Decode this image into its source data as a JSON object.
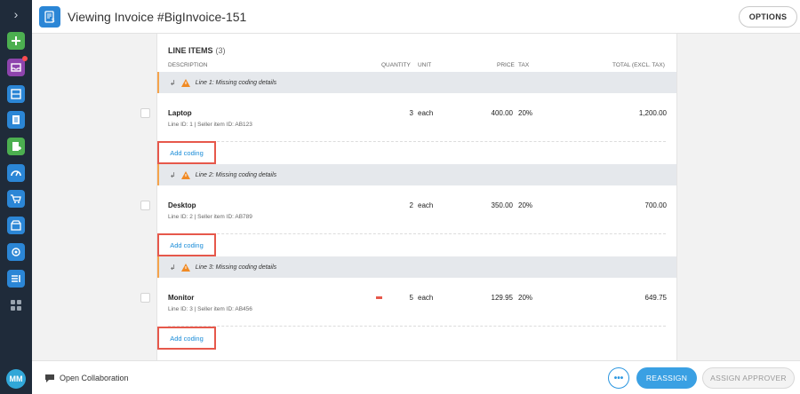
{
  "app": {
    "title": "Viewing Invoice #BigInvoice-151",
    "options_label": "OPTIONS"
  },
  "sidebar": {
    "toggle_icon": "chevron-right-icon",
    "items": [
      {
        "icon": "add-icon",
        "color": "#4caf50"
      },
      {
        "icon": "inbox-icon",
        "color": "#8e44ad",
        "badge": true
      },
      {
        "icon": "tray-icon",
        "color": "#2b86d6"
      },
      {
        "icon": "clipboard-icon",
        "color": "#2b86d6"
      },
      {
        "icon": "document-add-icon",
        "color": "#4caf50"
      },
      {
        "icon": "dashboard-icon",
        "color": "#2b86d6"
      },
      {
        "icon": "cart-icon",
        "color": "#2b86d6"
      },
      {
        "icon": "store-icon",
        "color": "#2b86d6"
      },
      {
        "icon": "network-icon",
        "color": "#2b86d6"
      },
      {
        "icon": "list-icon",
        "color": "#2b86d6"
      },
      {
        "icon": "grid-icon",
        "color": "#9aa4ae"
      }
    ],
    "avatar_initials": "MM"
  },
  "line_items": {
    "title": "LINE ITEMS",
    "count": "(3)",
    "columns": {
      "description": "DESCRIPTION",
      "quantity": "QUANTITY",
      "unit": "UNIT",
      "price": "PRICE",
      "tax": "TAX",
      "total": "TOTAL (EXCL. TAX)"
    },
    "items": [
      {
        "warning": "Line 1: Missing coding details",
        "name": "Laptop",
        "meta": "Line ID: 1 | Seller item ID: AB123",
        "quantity": "3",
        "unit": "each",
        "price": "400.00",
        "tax": "20%",
        "total": "1,200.00",
        "add_coding": "Add coding"
      },
      {
        "warning": "Line 2: Missing coding details",
        "name": "Desktop",
        "meta": "Line ID: 2 | Seller item ID: AB789",
        "quantity": "2",
        "unit": "each",
        "price": "350.00",
        "tax": "20%",
        "total": "700.00",
        "add_coding": "Add coding"
      },
      {
        "warning": "Line 3: Missing coding details",
        "name": "Monitor",
        "meta": "Line ID: 3 | Seller item ID: AB456",
        "quantity": "5",
        "unit": "each",
        "price": "129.95",
        "tax": "20%",
        "total": "649.75",
        "add_coding": "Add coding",
        "flag": true
      }
    ]
  },
  "footer": {
    "collaboration_label": "Open Collaboration",
    "more_label": "•••",
    "reassign_label": "REASSIGN",
    "assign_approver_label": "ASSIGN APPROVER"
  },
  "colors": {
    "accent": "#3aa0e3",
    "warning": "#f5a34b",
    "highlight_box": "#e6584b",
    "sidebar_bg": "#1f2b3a"
  }
}
